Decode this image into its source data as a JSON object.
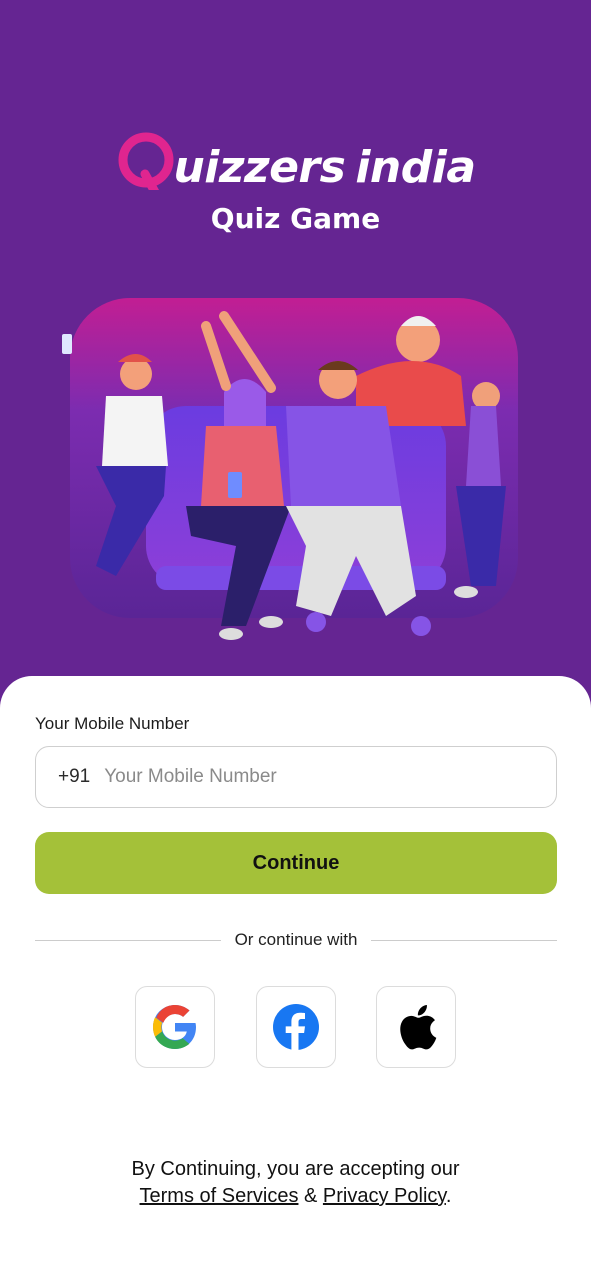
{
  "brand": {
    "logo_text": "Quizzers india",
    "logo_q": "Q",
    "logo_word": "uizzers",
    "logo_i": "india",
    "subtitle": "Quiz Game",
    "colors": {
      "background": "#652592",
      "accent_pink": "#e0258f",
      "button": "#a4c139"
    }
  },
  "form": {
    "label": "Your Mobile Number",
    "country_code": "+91",
    "placeholder": "Your Mobile Number",
    "value": "",
    "continue_label": "Continue"
  },
  "divider": {
    "text": "Or continue with"
  },
  "social": [
    {
      "name": "Google",
      "icon": "google-icon"
    },
    {
      "name": "Facebook",
      "icon": "facebook-icon"
    },
    {
      "name": "Apple",
      "icon": "apple-icon"
    }
  ],
  "terms": {
    "prefix": "By Continuing, you are accepting our",
    "terms_link": "Terms of Services",
    "amp": "&",
    "privacy_link": "Privacy Policy",
    "suffix": "."
  }
}
